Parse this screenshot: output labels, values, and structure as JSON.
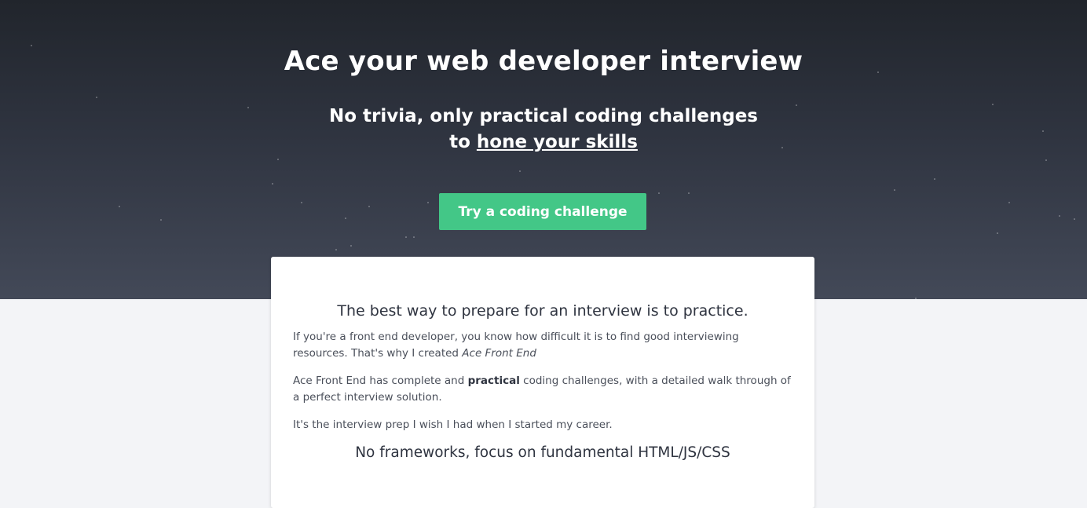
{
  "hero": {
    "title": "Ace your web developer interview",
    "subtitle_line1": "No trivia, only practical coding challenges",
    "subtitle_to": "to ",
    "subtitle_link": "hone your skills",
    "cta_label": "Try a coding challenge",
    "colors": {
      "bg_top": "#21252c",
      "bg_bottom": "#434958",
      "cta": "#43c787"
    }
  },
  "card": {
    "heading": "The best way to prepare for an interview is to practice.",
    "p1_text": "If you're a front end developer, you know how difficult it is to find good interviewing resources. That's why I created ",
    "p1_em": "Ace Front End",
    "p2_before": "Ace Front End has complete and ",
    "p2_strong": "practical",
    "p2_after": " coding challenges, with a detailed walk through of a perfect interview solution.",
    "p3": "It's the interview prep I wish I had when I started my career.",
    "sub_heading": "No frameworks, focus on fundamental HTML/JS/CSS"
  }
}
